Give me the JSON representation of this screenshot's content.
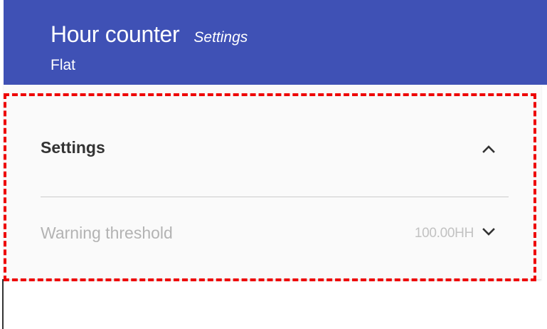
{
  "header": {
    "title": "Hour counter",
    "subtitle": "Settings",
    "caption": "Flat"
  },
  "settings_section": {
    "title": "Settings",
    "toggle_icon": "chevron-up-icon",
    "rows": [
      {
        "label": "Warning threshold",
        "value": "100.00HH",
        "icon": "chevron-down-icon"
      }
    ]
  },
  "colors": {
    "header_background": "#3f51b5",
    "header_text": "#ffffff",
    "panel_background": "#fafafa",
    "highlight_border": "#ee0000"
  }
}
